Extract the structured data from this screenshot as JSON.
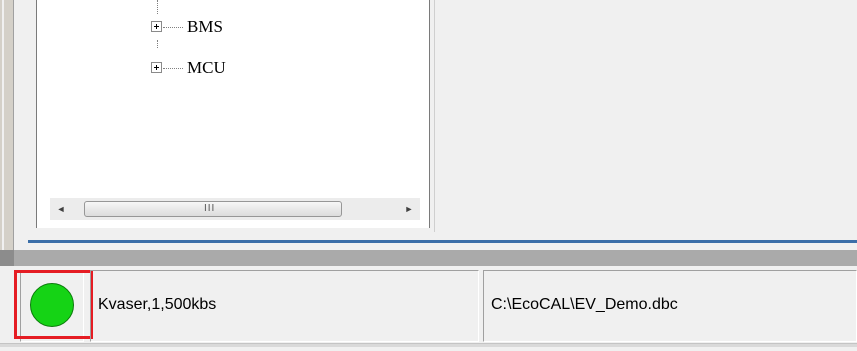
{
  "tree": {
    "items": [
      {
        "label": "BMS"
      },
      {
        "label": "MCU"
      }
    ]
  },
  "scrollbar": {
    "left_arrow": "◄",
    "right_arrow": "►",
    "grip": "III"
  },
  "status_bar": {
    "connection_status": {
      "state": "connected",
      "color": "#15d315"
    },
    "device_info": "Kvaser,1,500kbs",
    "file_path": "C:\\EcoCAL\\EV_Demo.dbc"
  },
  "colors": {
    "highlight": "#e51c23",
    "panel_border": "#3b6ea8"
  }
}
